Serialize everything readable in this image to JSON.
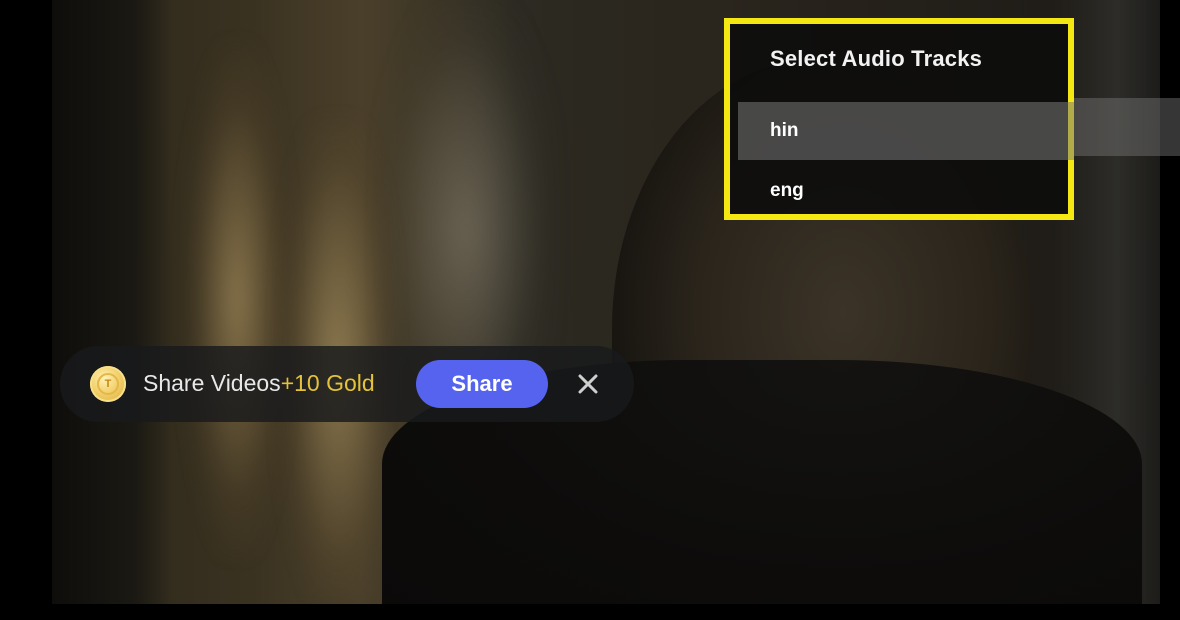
{
  "audio_panel": {
    "title": "Select Audio Tracks",
    "tracks": [
      {
        "label": "hin",
        "selected": true
      },
      {
        "label": "eng",
        "selected": false
      }
    ],
    "highlight_color": "#f5e812"
  },
  "share_banner": {
    "coin_letter": "T",
    "text": "Share Videos",
    "reward": "+10 Gold",
    "button_label": "Share",
    "button_color": "#5563ee",
    "reward_color": "#e4c23a",
    "close_icon": "close-icon"
  }
}
